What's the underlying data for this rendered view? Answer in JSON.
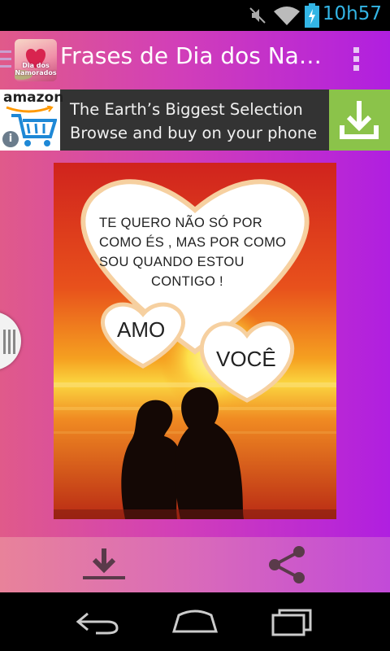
{
  "status_bar": {
    "time": "10h57",
    "icons": [
      "mute-icon",
      "wifi-icon",
      "battery-charging-icon"
    ],
    "time_color": "#33b5e5"
  },
  "action_bar": {
    "title": "Frases de Dia dos Na…",
    "app_icon_text": "Dia dos Namorados",
    "icons": [
      "drawer-menu-icon",
      "overflow-menu-icon"
    ]
  },
  "ad_banner": {
    "brand": "amazon",
    "line1": "The Earth’s Biggest Selection",
    "line2": "Browse and buy on your phone",
    "info_glyph": "i",
    "button_color": "#8bc34a",
    "icons": [
      "amazon-cart-icon",
      "info-icon",
      "download-icon"
    ]
  },
  "image": {
    "quote": [
      "TE QUERO NÃO  SÓ POR",
      "COMO ÉS , MAS  POR COMO",
      "SOU  QUANDO  ESTOU",
      "CONTIGO !"
    ],
    "bubble_left": "AMO",
    "bubble_right": "VOCÊ"
  },
  "bottom_bar": {
    "icons": [
      "download-icon",
      "share-icon"
    ]
  },
  "nav_bar": {
    "icons": [
      "back-icon",
      "home-icon",
      "recents-icon"
    ]
  },
  "colors": {
    "app_gradient_start": "#e05a8a",
    "app_gradient_end": "#b01fe0"
  }
}
